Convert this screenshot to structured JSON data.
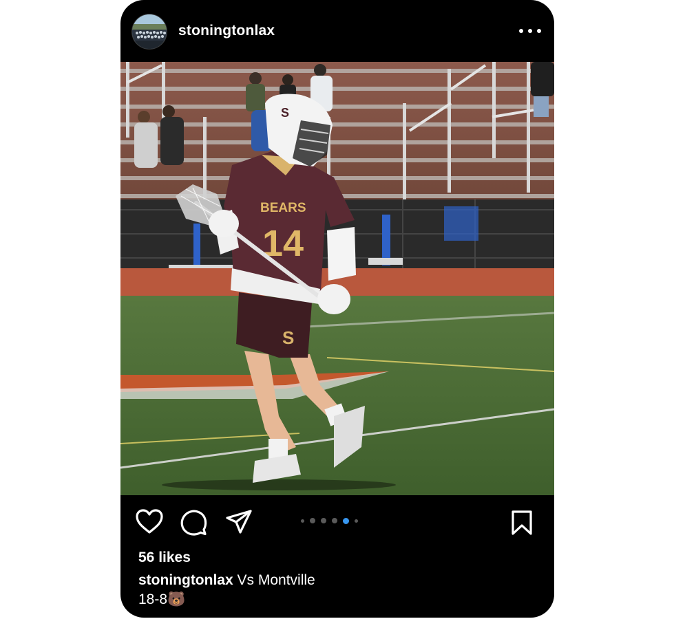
{
  "post": {
    "username": "stoningtonlax",
    "more_icon": "ellipsis-icon",
    "photo": {
      "jersey_text": "BEARS",
      "jersey_number": "14",
      "helmet_letter": "S",
      "shorts_letter": "S"
    },
    "actions": {
      "like_icon": "heart-icon",
      "comment_icon": "comment-icon",
      "share_icon": "paper-plane-icon",
      "save_icon": "bookmark-icon"
    },
    "carousel": {
      "total": 6,
      "active_index": 4,
      "active_color": "#3897f0"
    },
    "likes": "56 likes",
    "caption": {
      "username": "stoningtonlax",
      "text": "Vs Montville",
      "line2": "18-8🐻"
    }
  }
}
